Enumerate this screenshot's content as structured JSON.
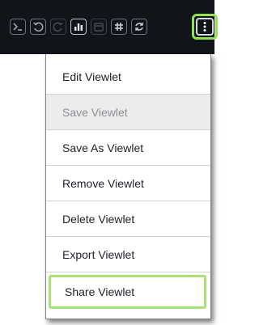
{
  "toolbar": {
    "buttons": [
      {
        "icon": "terminal-icon",
        "state": "normal"
      },
      {
        "icon": "undo-icon",
        "state": "normal"
      },
      {
        "icon": "redo-icon",
        "state": "disabled"
      },
      {
        "icon": "bar-chart-icon",
        "state": "active"
      },
      {
        "icon": "calendar-icon",
        "state": "disabled"
      },
      {
        "icon": "grid-icon",
        "state": "normal"
      },
      {
        "icon": "refresh-icon",
        "state": "normal"
      },
      {
        "icon": "more-vertical-icon",
        "state": "highlighted"
      }
    ],
    "colors": {
      "background": "#111418",
      "highlight": "#8fe34f"
    }
  },
  "menu": {
    "items": [
      {
        "label": "Edit Viewlet",
        "disabled": false
      },
      {
        "label": "Save Viewlet",
        "disabled": true
      },
      {
        "label": "Save As Viewlet",
        "disabled": false
      },
      {
        "label": "Remove Viewlet",
        "disabled": false
      },
      {
        "label": "Delete Viewlet",
        "disabled": false
      },
      {
        "label": "Export Viewlet",
        "disabled": false
      },
      {
        "label": "Share Viewlet",
        "disabled": false,
        "highlighted": true
      }
    ]
  }
}
